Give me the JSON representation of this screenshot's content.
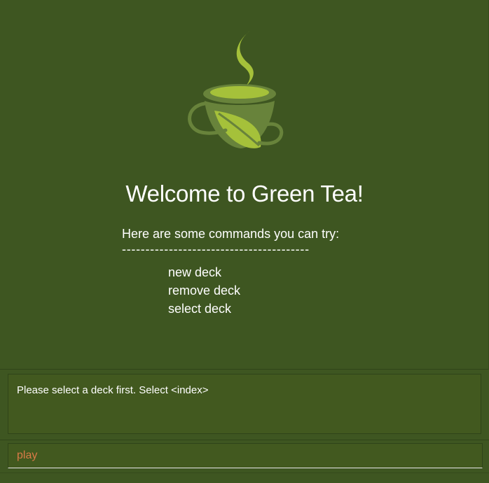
{
  "app": {
    "name": "Green Tea"
  },
  "welcome": {
    "title": "Welcome to Green Tea!",
    "intro": "Here are some commands you can try:",
    "divider": "----------------------------------------",
    "commands": [
      "new deck",
      "remove deck",
      "select deck"
    ]
  },
  "result": {
    "message": "Please select a deck first. Select <index>"
  },
  "command_box": {
    "value": "play",
    "placeholder": ""
  },
  "colors": {
    "background": "#3e5621",
    "panel": "#42591f",
    "input_text": "#d97a47",
    "logo_light": "#a5c13a",
    "logo_dark": "#68833b"
  },
  "icons": {
    "logo": "tea-cup-icon"
  }
}
